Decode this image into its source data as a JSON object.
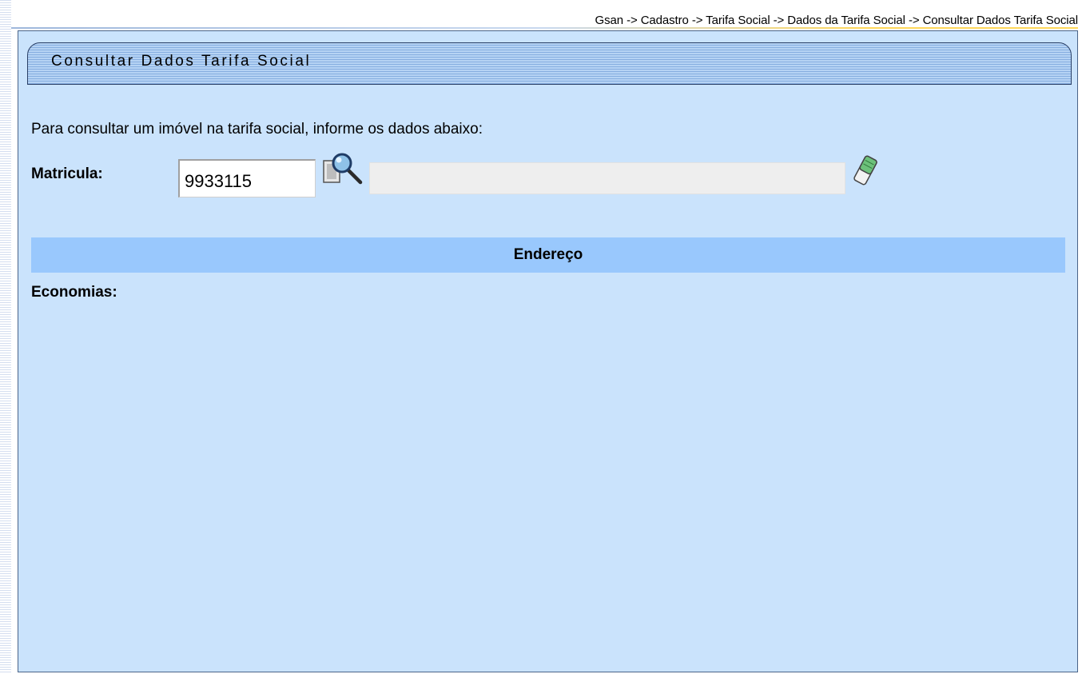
{
  "breadcrumb": "Gsan -> Cadastro -> Tarifa Social -> Dados da Tarifa Social -> Consultar Dados Tarifa Social",
  "panel": {
    "title": "Consultar Dados Tarifa Social"
  },
  "form": {
    "instructions": "Para consultar um imóvel na tarifa social, informe os dados abaixo:",
    "matricula_label": "Matricula:",
    "matricula_value": "9933115",
    "description_value": ""
  },
  "sections": {
    "endereco_header": "Endereço",
    "economias_label": "Economias:"
  },
  "icons": {
    "search": "search-icon",
    "clear": "eraser-icon"
  },
  "colors": {
    "panel_background": "#cae3fc",
    "section_header_background": "#99c8fd",
    "title_bar_dark_stripe": "#86aee0",
    "title_bar_light_stripe": "#b6d3f4"
  }
}
